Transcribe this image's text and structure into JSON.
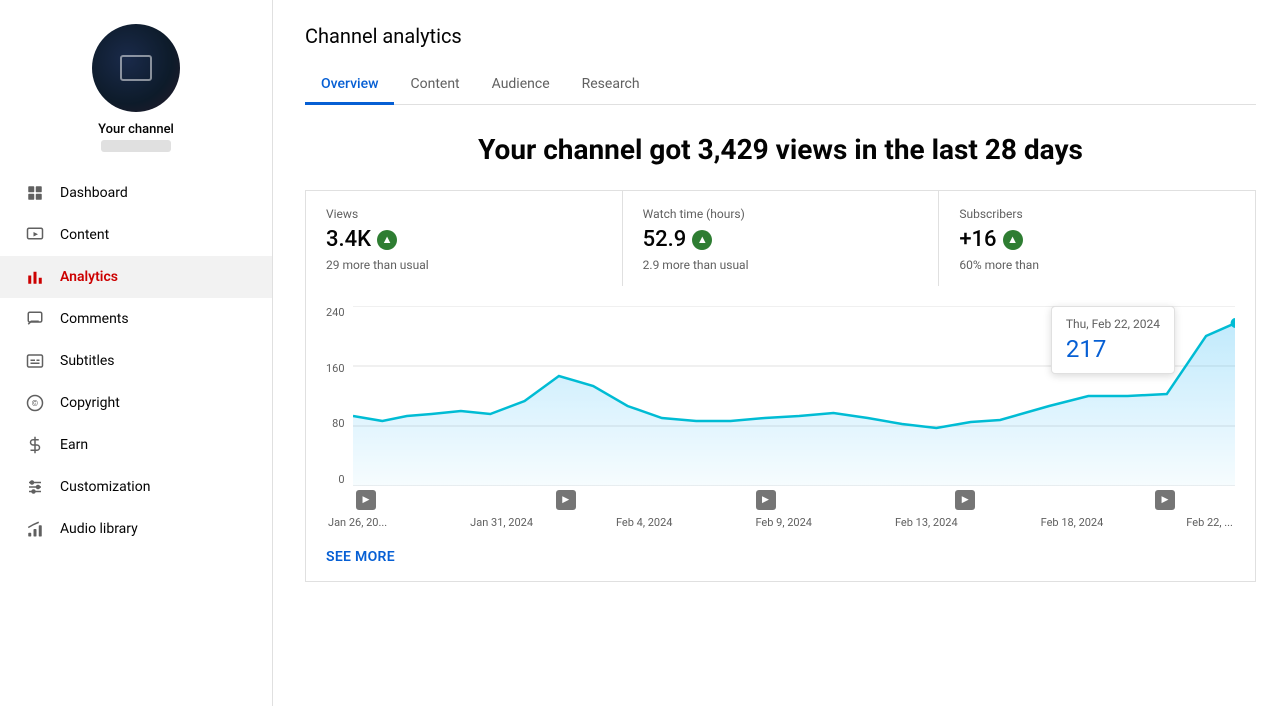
{
  "sidebar": {
    "channel_name": "Your channel",
    "nav_items": [
      {
        "id": "dashboard",
        "label": "Dashboard",
        "icon": "dashboard",
        "active": false
      },
      {
        "id": "content",
        "label": "Content",
        "icon": "content",
        "active": false
      },
      {
        "id": "analytics",
        "label": "Analytics",
        "icon": "analytics",
        "active": true
      },
      {
        "id": "comments",
        "label": "Comments",
        "icon": "comments",
        "active": false
      },
      {
        "id": "subtitles",
        "label": "Subtitles",
        "icon": "subtitles",
        "active": false
      },
      {
        "id": "copyright",
        "label": "Copyright",
        "icon": "copyright",
        "active": false
      },
      {
        "id": "earn",
        "label": "Earn",
        "icon": "earn",
        "active": false
      },
      {
        "id": "customization",
        "label": "Customization",
        "icon": "customization",
        "active": false
      },
      {
        "id": "audio-library",
        "label": "Audio library",
        "icon": "audio",
        "active": false
      }
    ]
  },
  "page": {
    "title": "Channel analytics",
    "tabs": [
      {
        "id": "overview",
        "label": "Overview",
        "active": true
      },
      {
        "id": "content",
        "label": "Content",
        "active": false
      },
      {
        "id": "audience",
        "label": "Audience",
        "active": false
      },
      {
        "id": "research",
        "label": "Research",
        "active": false
      }
    ],
    "headline": "Your channel got 3,429 views in the last 28 days",
    "metrics": [
      {
        "id": "views",
        "label": "Views",
        "value": "3.4K",
        "up": true,
        "sub": "29 more than usual"
      },
      {
        "id": "watch-time",
        "label": "Watch time (hours)",
        "value": "52.9",
        "up": true,
        "sub": "2.9 more than usual"
      },
      {
        "id": "subscribers",
        "label": "Subscribers",
        "value": "+16",
        "up": true,
        "sub": "60% more than"
      }
    ],
    "tooltip": {
      "date": "Thu, Feb 22, 2024",
      "value": "217"
    },
    "y_axis": [
      "240",
      "160",
      "80",
      "0"
    ],
    "x_labels": [
      "Jan 26, 20...",
      "Jan 31, 2024",
      "Feb 4, 2024",
      "Feb 9, 2024",
      "Feb 13, 2024",
      "Feb 18, 2024",
      "Feb 22, ..."
    ],
    "see_more": "SEE MORE"
  }
}
